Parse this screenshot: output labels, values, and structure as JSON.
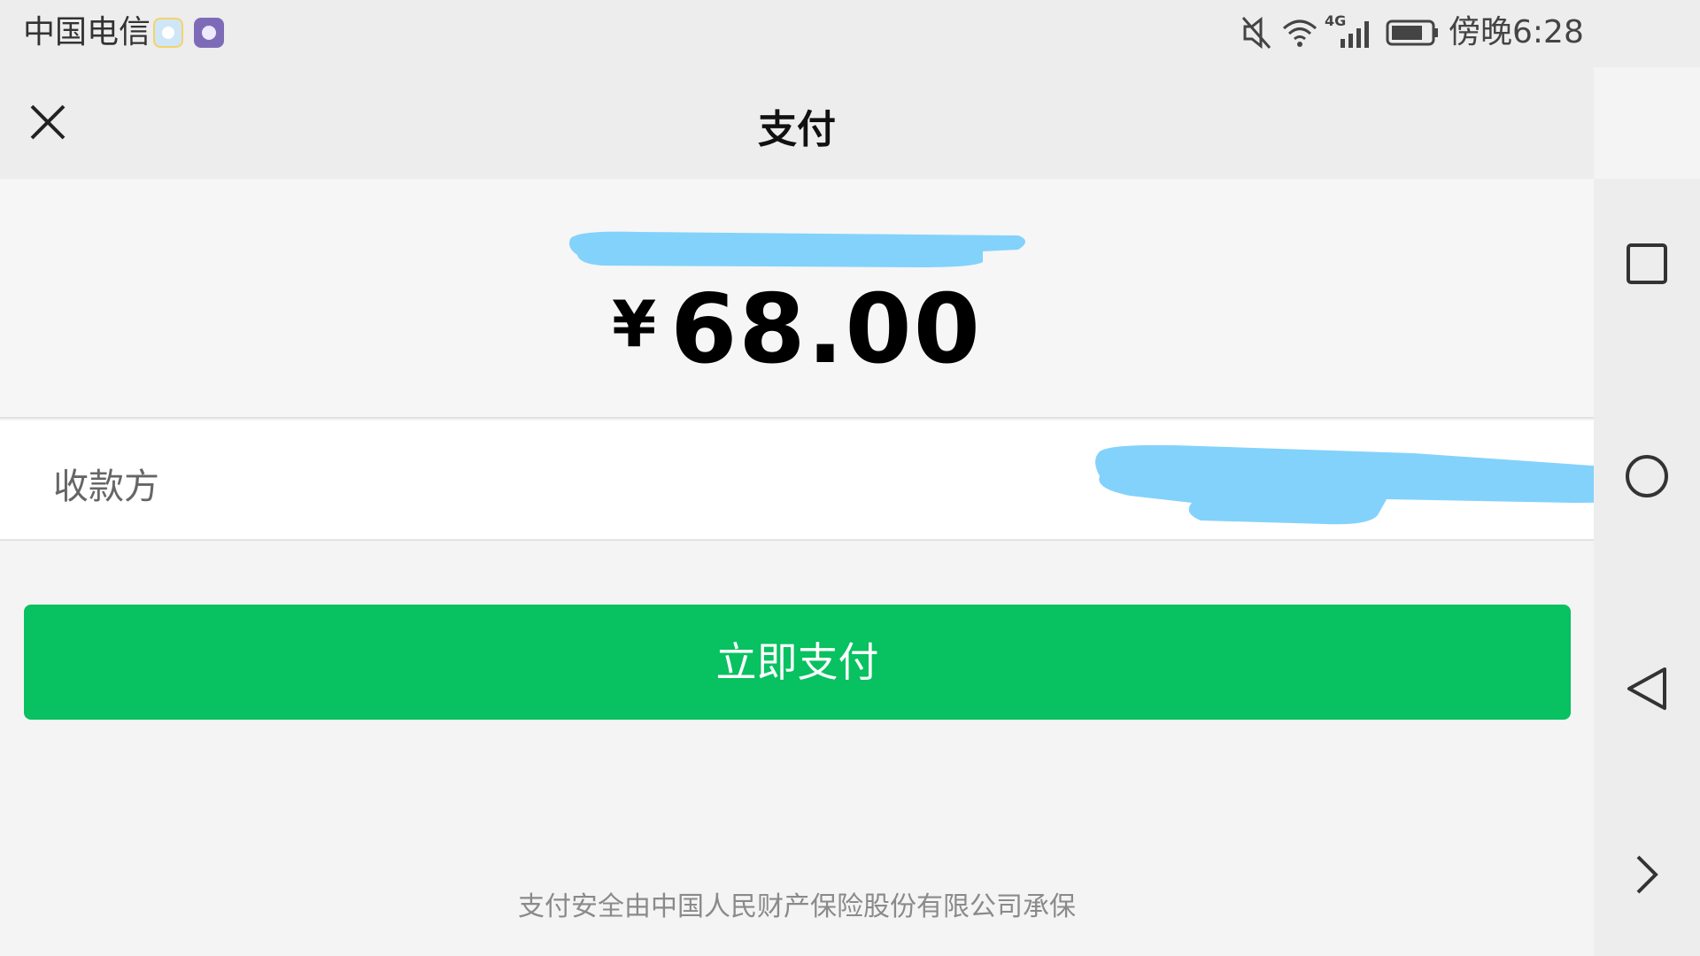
{
  "status_bar": {
    "carrier": "中国电信",
    "network": "4G",
    "time": "傍晚6:28",
    "icons": [
      "app-badge-1",
      "app-badge-2",
      "mute-icon",
      "wifi-icon",
      "signal-icon",
      "battery-icon"
    ]
  },
  "header": {
    "title": "支付",
    "close_icon": "close-icon"
  },
  "amount_section": {
    "currency_symbol": "¥",
    "amount": "68.00"
  },
  "payee": {
    "label": "收款方"
  },
  "pay_button": {
    "label": "立即支付",
    "color": "#08c160"
  },
  "footer": {
    "text": "支付安全由中国人民财产保险股份有限公司承保"
  },
  "nav_bar": {
    "buttons": [
      "recent-apps-icon",
      "home-icon",
      "back-icon",
      "forward-icon"
    ]
  },
  "colors": {
    "accent": "#08c160",
    "redaction": "#83d2fb"
  }
}
